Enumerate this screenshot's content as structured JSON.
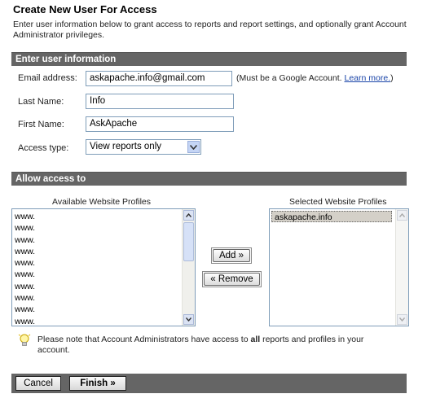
{
  "page": {
    "title": "Create New User For Access",
    "intro": "Enter user information below to grant access to reports and report settings, and optionally grant Account Administrator privileges."
  },
  "user_section": {
    "header": "Enter user information",
    "email_label": "Email address:",
    "email_value": "askapache.info@gmail.com",
    "email_hint": "(Must be a Google Account.",
    "email_hint_link": "Learn more.",
    "email_hint_close": ")",
    "last_name_label": "Last Name:",
    "last_name_value": "Info",
    "first_name_label": "First Name:",
    "first_name_value": "AskApache",
    "access_type_label": "Access type:",
    "access_type_value": "View reports only"
  },
  "access_section": {
    "header": "Allow access to",
    "available_label": "Available Website Profiles",
    "available_items": [
      "www.",
      "www.",
      "www.",
      "www.",
      "www.",
      "www.",
      "www.",
      "www.",
      "www.",
      "www."
    ],
    "selected_label": "Selected Website Profiles",
    "selected_items": [
      "askapache.info"
    ],
    "add_button": "Add »",
    "remove_button": "« Remove"
  },
  "note": {
    "prefix": "Please note that Account Administrators have access to ",
    "bold": "all",
    "suffix": " reports and profiles in your account."
  },
  "footer": {
    "cancel_button": "Cancel",
    "finish_button": "Finish »"
  },
  "colors": {
    "section_bar": "#656565",
    "link": "#1a44a8",
    "input_border": "#7f9db9",
    "selected_item_bg": "#d4d0c8"
  }
}
